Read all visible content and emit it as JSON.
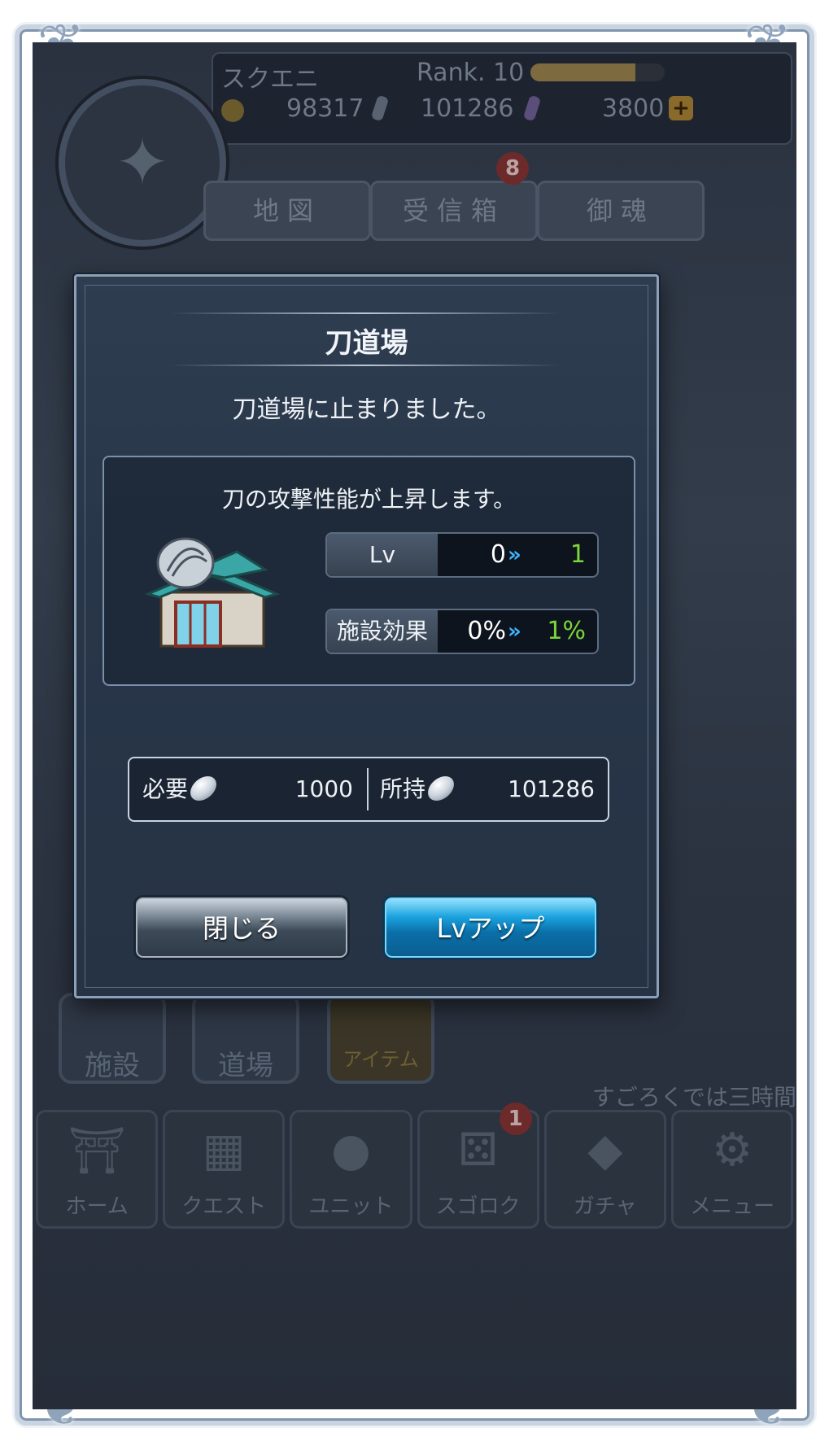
{
  "background": {
    "player_name": "スクエニ",
    "rank_label": "Rank. 10",
    "rank_progress": 0.78,
    "gold": "98317",
    "coins": "101286",
    "gems": "3800",
    "top_buttons": [
      "地図",
      "受信箱",
      "御魂"
    ],
    "inbox_badge": "8",
    "side_buttons": [
      "施設",
      "道場",
      "アイテム"
    ],
    "ticker_text": "すごろくでは三時間",
    "nav_items": [
      "ホーム",
      "クエスト",
      "ユニット",
      "スゴロク",
      "ガチャ",
      "メニュー"
    ],
    "sugoroku_badge": "1"
  },
  "dialog": {
    "title": "刀道場",
    "message": "刀道場に止まりました。",
    "description": "刀の攻撃性能が上昇します。",
    "icon": "dojo-building-icon",
    "stats": [
      {
        "label": "Lv",
        "current": "0",
        "next": "1"
      },
      {
        "label": "施設効果",
        "current": "0%",
        "next": "1%"
      }
    ],
    "cost": {
      "required_label": "必要",
      "required_value": "1000",
      "owned_label": "所持",
      "owned_value": "101286"
    },
    "buttons": {
      "close": "閉じる",
      "levelup": "Lvアップ"
    }
  },
  "colors": {
    "accent_green": "#7bd63a",
    "accent_blue": "#1ba3df",
    "frame": "#8ca0b8"
  }
}
